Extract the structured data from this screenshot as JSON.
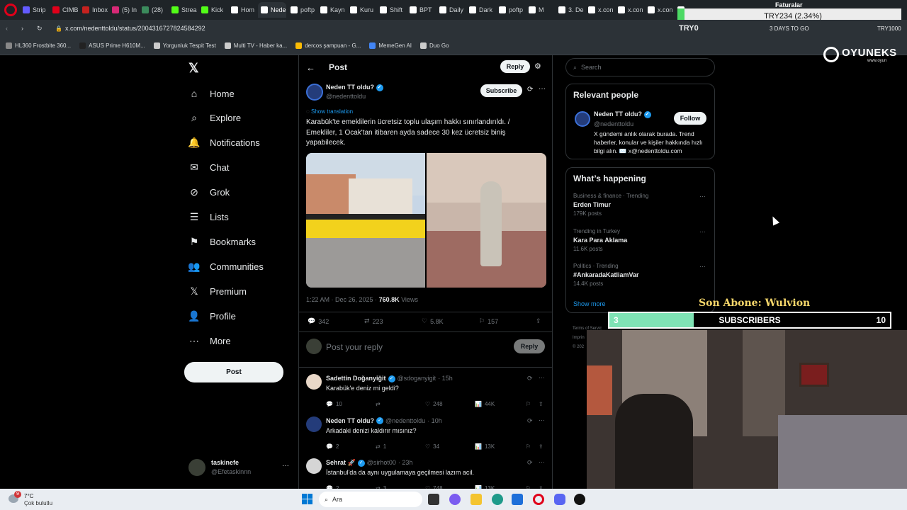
{
  "browser": {
    "tabs": [
      {
        "label": "Strip",
        "color": "#635bff"
      },
      {
        "label": "CIMB",
        "color": "#e0001a"
      },
      {
        "label": "Inbox",
        "color": "#c5221f"
      },
      {
        "label": "(5) In",
        "color": "#d62976"
      },
      {
        "label": "(28)",
        "color": "#3b8a5c"
      },
      {
        "label": "Strea",
        "color": "#53fc18"
      },
      {
        "label": "Kick",
        "color": "#53fc18"
      },
      {
        "label": "Hom",
        "color": "#ffffff"
      },
      {
        "label": "Neden T",
        "color": "#ffffff",
        "active": true
      },
      {
        "label": "poftp",
        "color": "#ffffff"
      },
      {
        "label": "Kayn",
        "color": "#ffffff"
      },
      {
        "label": "Kuru",
        "color": "#ffffff"
      },
      {
        "label": "Shift",
        "color": "#ffffff"
      },
      {
        "label": "BPT",
        "color": "#ffffff"
      },
      {
        "label": "Daily",
        "color": "#ffffff"
      },
      {
        "label": "Dark",
        "color": "#ffffff"
      },
      {
        "label": "poftp",
        "color": "#ffffff"
      },
      {
        "label": "M",
        "color": "#ffffff"
      },
      {
        "label": "3. De",
        "color": "#ffffff"
      },
      {
        "label": "x.con",
        "color": "#ffffff"
      },
      {
        "label": "x.con",
        "color": "#ffffff"
      },
      {
        "label": "x.con",
        "color": "#ffffff"
      },
      {
        "label": "x.con",
        "color": "#ffffff"
      }
    ],
    "url": "x.com/nedenttoldu/status/2004316727824584292",
    "bookmarks": [
      {
        "label": "HL360 Frostbite 360...",
        "color": "#888888"
      },
      {
        "label": "ASUS Prime H610M...",
        "color": "#222222"
      },
      {
        "label": "Yorgunluk Tespit Test",
        "color": "#cccccc"
      },
      {
        "label": "Multi TV - Haber ka...",
        "color": "#cccccc"
      },
      {
        "label": "dercos şampuan - G...",
        "color": "#fbbc05"
      },
      {
        "label": "MemeGen AI",
        "color": "#4285f4"
      },
      {
        "label": "Duo Go",
        "color": "#cccccc"
      }
    ]
  },
  "overlay": {
    "ticker_label": "TRY234 (2.34%)",
    "try_label": "TRY0",
    "days_to_go": "3 DAYS TO GO",
    "faturalar": "Faturalar",
    "try_right": "TRY1000",
    "brand_name": "OYUNEKS",
    "brand_sub": "www.oyun",
    "son_abone": "Son Abone: Wulvion",
    "subs_current": "3",
    "subs_label": "SUBSCRIBERS",
    "subs_goal": "10",
    "subs_progress": 0.3
  },
  "sidebar": {
    "items": [
      {
        "label": "Home",
        "icon": "home-icon",
        "glyph": "⌂"
      },
      {
        "label": "Explore",
        "icon": "search-icon",
        "glyph": "⌕"
      },
      {
        "label": "Notifications",
        "icon": "bell-icon",
        "glyph": "🔔"
      },
      {
        "label": "Chat",
        "icon": "mail-icon",
        "glyph": "✉"
      },
      {
        "label": "Grok",
        "icon": "grok-icon",
        "glyph": "⊘"
      },
      {
        "label": "Lists",
        "icon": "list-icon",
        "glyph": "☰"
      },
      {
        "label": "Bookmarks",
        "icon": "bookmark-icon",
        "glyph": "⚑"
      },
      {
        "label": "Communities",
        "icon": "people-icon",
        "glyph": "👥"
      },
      {
        "label": "Premium",
        "icon": "x-logo-icon",
        "glyph": "𝕏"
      },
      {
        "label": "Profile",
        "icon": "person-icon",
        "glyph": "👤"
      },
      {
        "label": "More",
        "icon": "more-circle-icon",
        "glyph": "⋯"
      }
    ],
    "post_button": "Post",
    "account": {
      "name": "taskinefe",
      "handle": "@Efetaskinnn"
    }
  },
  "post": {
    "header_title": "Post",
    "header_reply": "Reply",
    "author_name": "Neden TT oldu?",
    "author_handle": "@nedenttoldu",
    "subscribe": "Subscribe",
    "show_translation": "Show translation",
    "text": "Karabük'te emeklilerin ücretsiz toplu ulaşım hakkı sınırlandırıldı. / Emekliler, 1 Ocak'tan itibaren ayda sadece 30 kez ücretsiz biniş yapabilecek.",
    "timestamp": "1:22 AM · Dec 26, 2025 · ",
    "views": "760.8K",
    "views_label": " Views",
    "stats": {
      "replies": "342",
      "reposts": "223",
      "likes": "5.8K",
      "bookmarks": "157"
    },
    "reply_placeholder": "Post your reply",
    "reply_button": "Reply"
  },
  "replies": [
    {
      "name": "Sadettin Doğanyiğit",
      "handle": "@sdoganyigit",
      "time": "· 15h",
      "text": "Karabük'e deniz mi geldi?",
      "replies": "10",
      "reposts": "",
      "likes": "248",
      "views": "44K"
    },
    {
      "name": "Neden TT oldu?",
      "handle": "@nedenttoldu",
      "time": "· 10h",
      "text": "Arkadaki denizi kaldırır mısınız?",
      "replies": "2",
      "reposts": "1",
      "likes": "34",
      "views": "13K"
    },
    {
      "name": "Sehrat 🚀",
      "handle": "@sirhot00",
      "time": "· 23h",
      "text": "İstanbul'da da aynı uygulamaya geçilmesi lazım acil.",
      "replies": "2",
      "reposts": "3",
      "likes": "748",
      "views": "13K"
    }
  ],
  "right": {
    "search_placeholder": "Search",
    "relevant_title": "Relevant people",
    "person": {
      "name": "Neden TT oldu?",
      "handle": "@nedenttoldu",
      "follow": "Follow",
      "bio": "X gündemi anlık olarak burada. Trend haberler, konular ve kişiler hakkında hızlı bilgi alın. ✉️ x@nedenttoldu.com"
    },
    "happening_title": "What’s happening",
    "trends": [
      {
        "category": "Business & finance · Trending",
        "name": "Erden Timur",
        "count": "179K posts"
      },
      {
        "category": "Trending in Turkey",
        "name": "Kara Para Aklama",
        "count": "11.6K posts"
      },
      {
        "category": "Politics · Trending",
        "name": "#AnkaradaKatliamVar",
        "count": "14.4K posts"
      }
    ],
    "show_more": "Show more",
    "footer": [
      "Terms of Servic",
      "Imprin",
      "© 202"
    ]
  },
  "taskbar": {
    "weather_temp": "7°C",
    "weather_desc": "Çok bulutlu",
    "weather_badge": "9",
    "search": "Ara"
  },
  "colors": {
    "accent": "#1d9bf0",
    "subs_green": "#7fe3b5"
  }
}
